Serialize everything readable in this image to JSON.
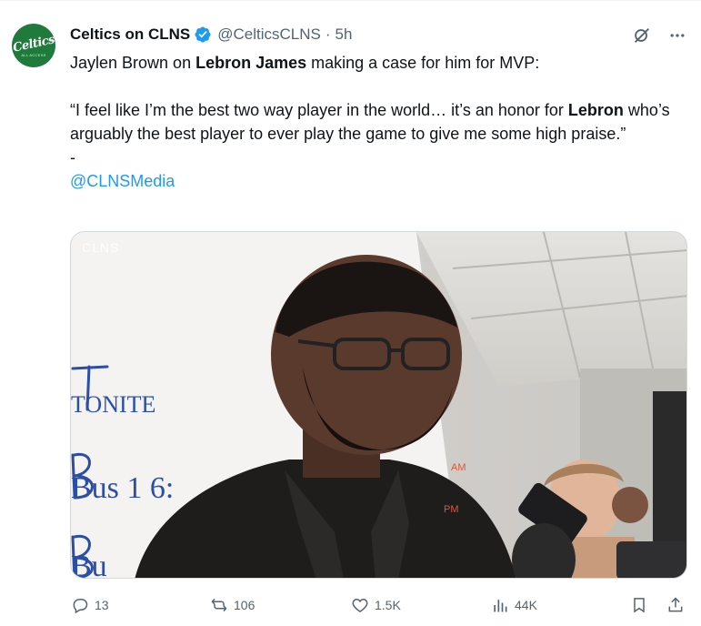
{
  "author": {
    "display_name": "Celtics on CLNS",
    "handle": "@CelticsCLNS",
    "separator": "·",
    "time": "5h",
    "avatar_text": "Celtics",
    "avatar_subtext": "ALL ACCESS",
    "verified_color": "#1d9bf0"
  },
  "tweet": {
    "line1_pre": "Jaylen Brown on ",
    "line1_bold": "Lebron James",
    "line1_post": " making a case for him for MVP:",
    "quote_pre": "“I feel like I’m the best two way player in the world… it’s an honor for ",
    "quote_bold": "Lebron",
    "quote_post": " who’s arguably the best player to ever play the game to give me some high praise.”",
    "dash": "-",
    "mention": "@CLNSMedia"
  },
  "media": {
    "watermark": "CLNS",
    "board_lines": [
      "TONITE",
      "Bus 1  6:",
      "Bu"
    ],
    "board_right": [
      "AM",
      "PM"
    ]
  },
  "actions": {
    "replies": "13",
    "reposts": "106",
    "likes": "1.5K",
    "views": "44K"
  },
  "icons": {
    "grok": "grok-icon",
    "more": "more-icon",
    "reply": "reply-icon",
    "repost": "repost-icon",
    "like": "like-icon",
    "views": "views-icon",
    "bookmark": "bookmark-icon",
    "share": "share-icon"
  },
  "colors": {
    "text": "#0f1419",
    "secondary": "#536471",
    "link": "#1d9bf0",
    "avatar_bg": "#1f7a3c"
  }
}
